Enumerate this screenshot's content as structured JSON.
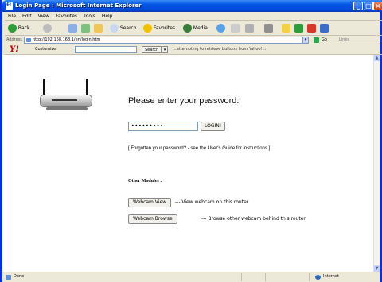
{
  "window": {
    "title": "Login Page : Microsoft Internet Explorer"
  },
  "menu": [
    "File",
    "Edit",
    "View",
    "Favorites",
    "Tools",
    "Help"
  ],
  "toolbar": {
    "back_label": "Back",
    "search_label": "Search",
    "favorites_label": "Favorites",
    "media_label": "Media"
  },
  "address": {
    "label": "Address",
    "url": "http://192.168.168.1/en/login.htm",
    "go_label": "Go",
    "links_label": "Links"
  },
  "yahoo": {
    "logo": "Y!",
    "customize_label": "Customize",
    "search_label": "Search",
    "status": "...attempting to retrieve buttons from Yahoo!..."
  },
  "page": {
    "title": "Please enter your password:",
    "password_value": "•••••••••",
    "login_label": "LOGIN!",
    "forgot_text": "[ Forgotten your password? - see the User's Guide for instructions ]",
    "other_modules": "Other Modules :",
    "modules": [
      {
        "button": "Webcam View",
        "description": "--- View webcam on this router"
      },
      {
        "button": "Webcam Browse",
        "description": "--- Browse other webcam behind this router"
      }
    ]
  },
  "status": {
    "left": "Done",
    "right": "Internet"
  },
  "colors": {
    "titlebar": "#0054e3",
    "chrome": "#ece9d8",
    "page_bg": "#ffffff"
  }
}
